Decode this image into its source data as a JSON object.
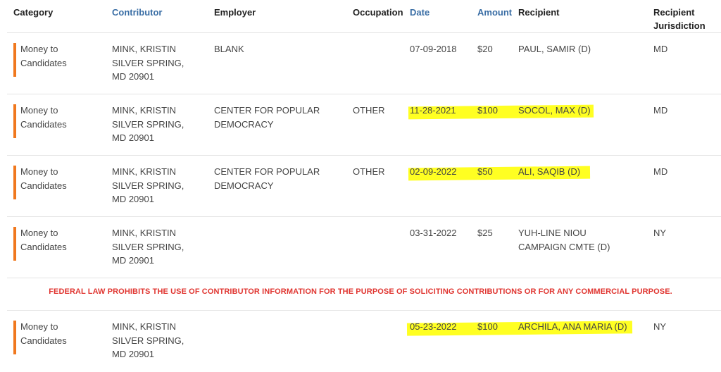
{
  "headers": {
    "category": "Category",
    "contributor": "Contributor",
    "employer": "Employer",
    "occupation": "Occupation",
    "date": "Date",
    "amount": "Amount",
    "recipient": "Recipient",
    "jurisdiction_line1": "Recipient",
    "jurisdiction_line2": "Jurisdiction"
  },
  "colors": {
    "category_bar": "#f0781e",
    "highlight": "#ffff22",
    "notice": "#e03530",
    "link": "#3a6ea5"
  },
  "rows": [
    {
      "category": [
        "Money to",
        "Candidates"
      ],
      "contributor": [
        "MINK, KRISTIN",
        "SILVER SPRING,",
        "MD 20901"
      ],
      "employer": [
        "BLANK",
        ""
      ],
      "occupation": "",
      "date": "07-09-2018",
      "amount": "$20",
      "recipient": [
        "PAUL, SAMIR (D)",
        ""
      ],
      "jurisdiction": "MD",
      "highlighted": false
    },
    {
      "category": [
        "Money to",
        "Candidates"
      ],
      "contributor": [
        "MINK, KRISTIN",
        "SILVER SPRING,",
        "MD 20901"
      ],
      "employer": [
        "CENTER FOR POPULAR",
        "DEMOCRACY"
      ],
      "occupation": "OTHER",
      "date": "11-28-2021",
      "amount": "$100",
      "recipient": [
        "SOCOL, MAX (D)",
        ""
      ],
      "jurisdiction": "MD",
      "highlighted": true
    },
    {
      "category": [
        "Money to",
        "Candidates"
      ],
      "contributor": [
        "MINK, KRISTIN",
        "SILVER SPRING,",
        "MD 20901"
      ],
      "employer": [
        "CENTER FOR POPULAR",
        "DEMOCRACY"
      ],
      "occupation": "OTHER",
      "date": "02-09-2022",
      "amount": "$50",
      "recipient": [
        "ALI, SAQIB (D)",
        ""
      ],
      "jurisdiction": "MD",
      "highlighted": true
    },
    {
      "category": [
        "Money to",
        "Candidates"
      ],
      "contributor": [
        "MINK, KRISTIN",
        "SILVER SPRING,",
        "MD 20901"
      ],
      "employer": [
        "",
        ""
      ],
      "occupation": "",
      "date": "03-31-2022",
      "amount": "$25",
      "recipient": [
        "YUH-LINE NIOU",
        "CAMPAIGN CMTE (D)"
      ],
      "jurisdiction": "NY",
      "highlighted": false
    },
    {
      "category": [
        "Money to",
        "Candidates"
      ],
      "contributor": [
        "MINK, KRISTIN",
        "SILVER SPRING,",
        "MD 20901"
      ],
      "employer": [
        "",
        ""
      ],
      "occupation": "",
      "date": "05-23-2022",
      "amount": "$100",
      "recipient": [
        "ARCHILA, ANA MARIA (D)",
        ""
      ],
      "jurisdiction": "NY",
      "highlighted": true
    }
  ],
  "notice": "FEDERAL LAW PROHIBITS THE USE OF CONTRIBUTOR INFORMATION FOR THE PURPOSE OF SOLICITING CONTRIBUTIONS OR FOR ANY COMMERCIAL PURPOSE."
}
